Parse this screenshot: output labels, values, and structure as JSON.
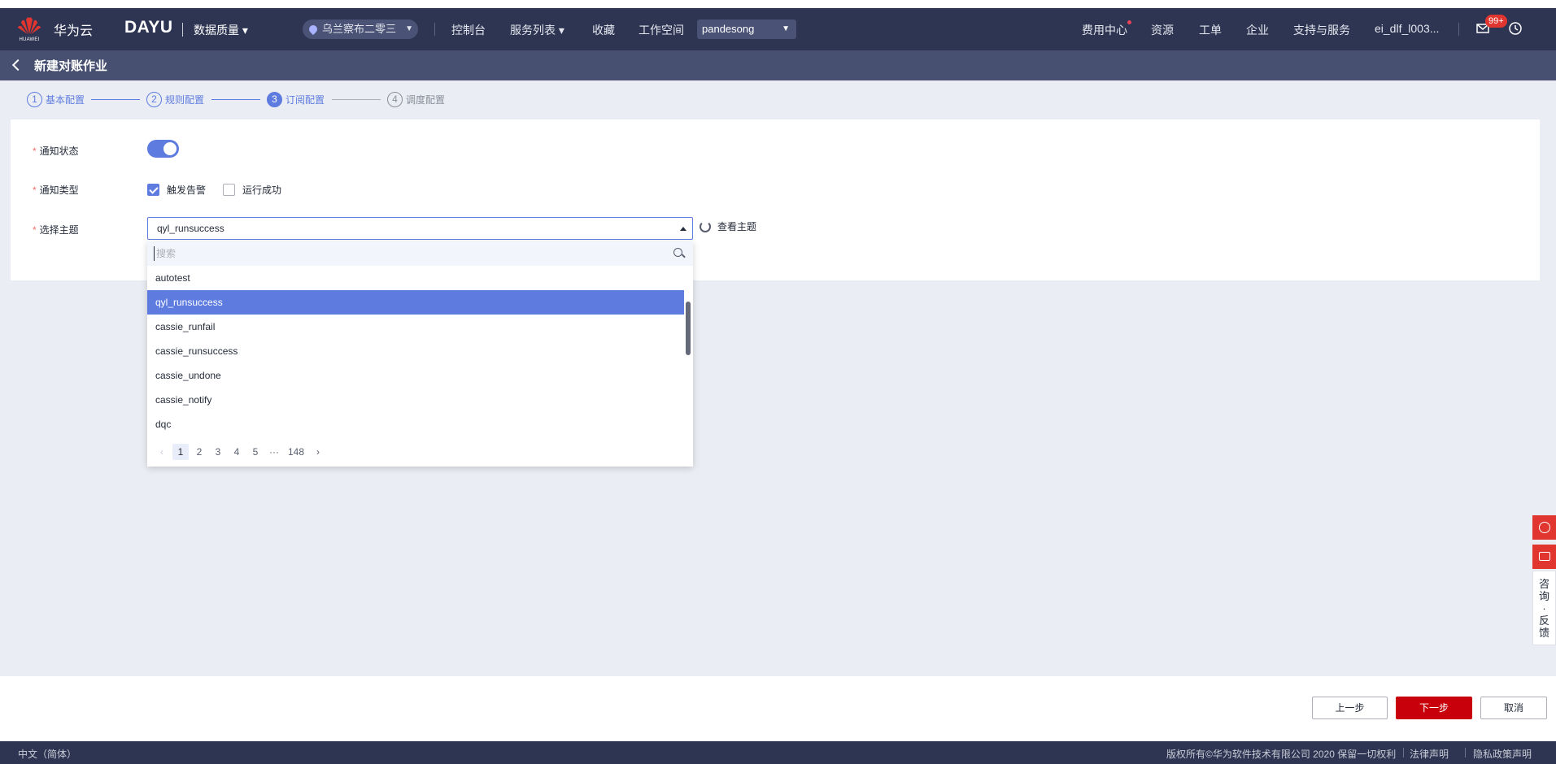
{
  "header": {
    "logo_text": "HUAWEI",
    "brand": "华为云",
    "product": "DAYU",
    "module": "数据质量 ▾",
    "region": "乌兰察布二零三",
    "nav": [
      "控制台",
      "服务列表 ▾",
      "收藏",
      "工作空间"
    ],
    "project": "pandesong",
    "right_nav": [
      "费用中心",
      "资源",
      "工单",
      "企业",
      "支持与服务",
      "ei_dlf_l003..."
    ],
    "badge": "99+"
  },
  "page": {
    "title": "新建对账作业"
  },
  "steps": [
    {
      "num": "1",
      "label": "基本配置"
    },
    {
      "num": "2",
      "label": "规则配置"
    },
    {
      "num": "3",
      "label": "订阅配置"
    },
    {
      "num": "4",
      "label": "调度配置"
    }
  ],
  "form": {
    "notify_status_label": "通知状态",
    "notify_type_label": "通知类型",
    "notify_type_options": [
      "触发告警",
      "运行成功"
    ],
    "topic_label": "选择主题",
    "topic_value": "qyl_runsuccess",
    "view_topic": "查看主题"
  },
  "dropdown": {
    "search_placeholder": "搜索",
    "options": [
      "autotest",
      "qyl_runsuccess",
      "cassie_runfail",
      "cassie_runsuccess",
      "cassie_undone",
      "cassie_notify",
      "dqc"
    ],
    "pages": [
      "1",
      "2",
      "3",
      "4",
      "5",
      "···",
      "148"
    ]
  },
  "actions": {
    "prev": "上一步",
    "next": "下一步",
    "cancel": "取消"
  },
  "side": {
    "feedback": "咨询·反馈"
  },
  "footer": {
    "lang": "中文（简体）",
    "copyright": "版权所有©华为软件技术有限公司 2020 保留一切权利",
    "legal": "法律声明",
    "privacy": "隐私政策声明"
  },
  "colors": {
    "accent": "#5e7ce0",
    "primary_button": "#c7000b",
    "topbar": "#2e3552"
  }
}
